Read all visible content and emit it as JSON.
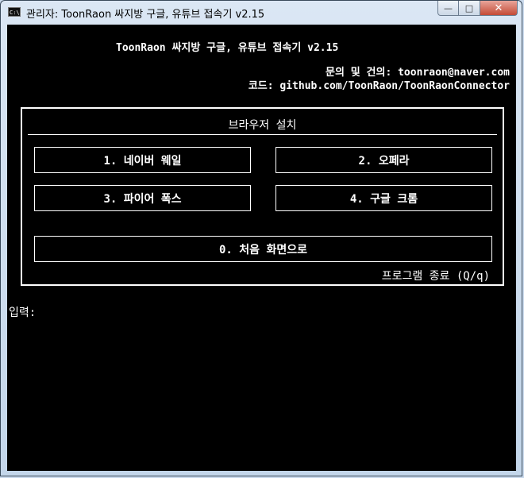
{
  "window": {
    "title": "관리자:  ToonRaon 싸지방 구글, 유튜브 접속기 v2.15",
    "icon_text": "C:\\.",
    "controls": {
      "minimize": "—",
      "maximize": "□",
      "close": "✕"
    }
  },
  "header": {
    "title": "ToonRaon 싸지방 구글, 유튜브 접속기 v2.15",
    "contact": "문의 및 건의: toonraon@naver.com",
    "code": "코드: github.com/ToonRaon/ToonRaonConnector"
  },
  "panel": {
    "title": "브라우저 설치",
    "buttons": [
      {
        "label": "1. 네이버 웨일"
      },
      {
        "label": "2. 오페라"
      },
      {
        "label": "3. 파이어 폭스"
      },
      {
        "label": "4. 구글 크롬"
      },
      {
        "label": "0. 처음 화면으로"
      }
    ],
    "quit_label": "프로그램 종료 (Q/q)"
  },
  "prompt": {
    "label": "입력:"
  }
}
